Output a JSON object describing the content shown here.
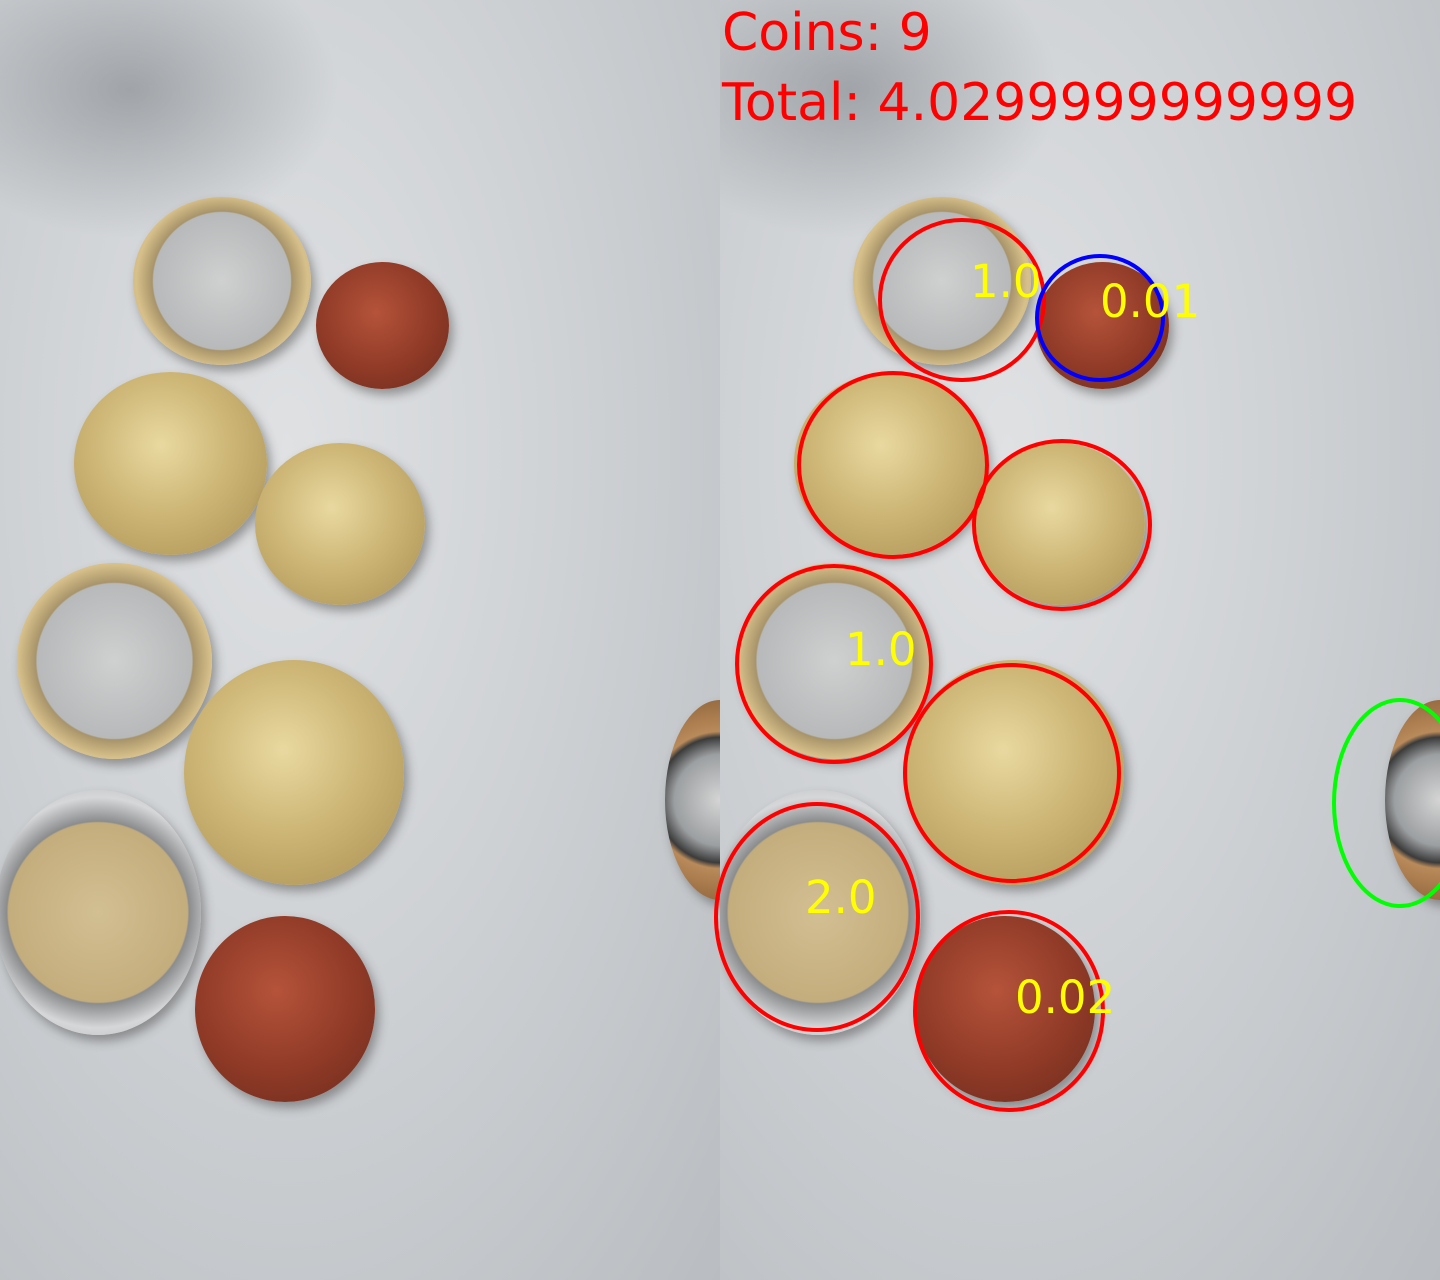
{
  "header": {
    "coins_line": "Coins: 9",
    "total_line": "Total: 4.0299999999999"
  },
  "labels": {
    "coin_1": "1.0",
    "coin_2": "0.01",
    "coin_3": "1.0",
    "coin_4": "2.0",
    "coin_5": "0.02"
  },
  "colors": {
    "header_text": "#ff0000",
    "value_text": "#ffff00",
    "circle_red": "#ff0000",
    "circle_blue": "#0000ff",
    "circle_green": "#00ff00"
  }
}
